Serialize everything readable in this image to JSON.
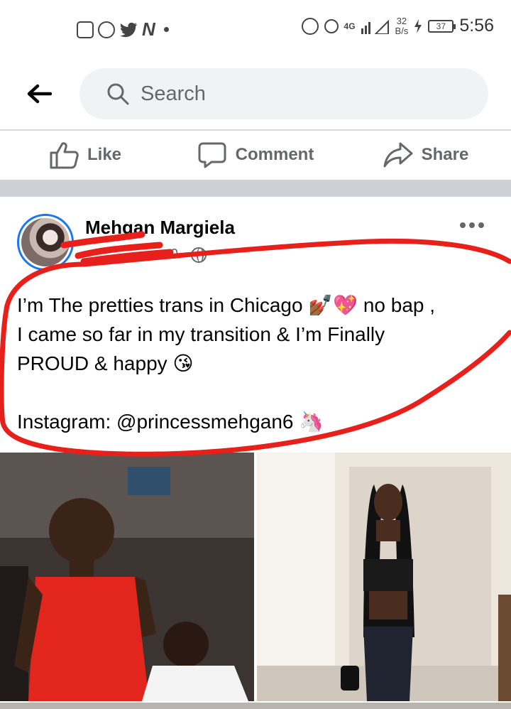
{
  "status_bar": {
    "time": "5:56",
    "network_type": "4G",
    "speed_value": "32",
    "speed_unit": "B/s",
    "battery_level": "37",
    "notification_icons": [
      "notification-box-icon",
      "whatsapp-icon",
      "twitter-icon",
      "n-app-icon"
    ],
    "system_icons": [
      "alarm-icon",
      "data-saver-icon",
      "signal-icon",
      "charging-icon"
    ]
  },
  "header": {
    "search_placeholder": "Search"
  },
  "action_bar": {
    "like_label": "Like",
    "comment_label": "Comment",
    "share_label": "Share"
  },
  "post": {
    "author": "Mehgan Margiela",
    "meta_partial": "0 ·",
    "text_line_1": "I’m The pretties trans in Chicago 💅🏾💖 no bap ,",
    "text_line_2": "I came so far in my transition & I’m Finally",
    "text_line_3": "PROUD & happy 😘",
    "text_line_4": "Instagram: @princessmehgan6 🦄"
  },
  "colors": {
    "accent": "#1877f2",
    "scribble": "#e8201c",
    "text_secondary": "#65676b",
    "search_bg": "#f0f2f5"
  }
}
